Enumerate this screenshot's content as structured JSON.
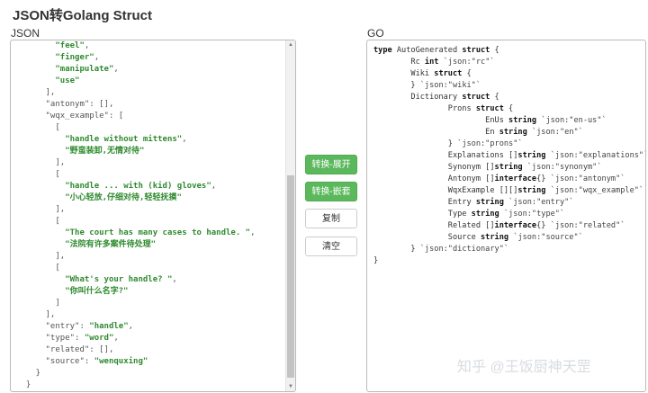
{
  "header": {
    "title": "JSON转Golang Struct"
  },
  "labels": {
    "json": "JSON",
    "go": "GO"
  },
  "buttons": {
    "convert_flat": "转换-展开",
    "convert_nested": "转换-嵌套",
    "copy": "复制",
    "clear": "清空"
  },
  "colors": {
    "primary_button": "#5cb85c",
    "json_string": "#2f8a2f"
  },
  "json_lines": [
    [
      {
        "t": "        "
      },
      {
        "t": "\"feel\"",
        "c": "str"
      },
      {
        "t": ",",
        "c": "pun"
      }
    ],
    [
      {
        "t": "        "
      },
      {
        "t": "\"finger\"",
        "c": "str"
      },
      {
        "t": ",",
        "c": "pun"
      }
    ],
    [
      {
        "t": "        "
      },
      {
        "t": "\"manipulate\"",
        "c": "str"
      },
      {
        "t": ",",
        "c": "pun"
      }
    ],
    [
      {
        "t": "        "
      },
      {
        "t": "\"use\"",
        "c": "str"
      }
    ],
    [
      {
        "t": "      ],",
        "c": "pun"
      }
    ],
    [
      {
        "t": "      "
      },
      {
        "t": "\"antonym\": [],",
        "c": "key"
      }
    ],
    [
      {
        "t": "      "
      },
      {
        "t": "\"wqx_example\": [",
        "c": "key"
      }
    ],
    [
      {
        "t": "        [",
        "c": "pun"
      }
    ],
    [
      {
        "t": "          "
      },
      {
        "t": "\"handle without mittens\"",
        "c": "str"
      },
      {
        "t": ",",
        "c": "pun"
      }
    ],
    [
      {
        "t": "          "
      },
      {
        "t": "\"野蛮装卸,无情对待\"",
        "c": "str"
      }
    ],
    [
      {
        "t": "        ],",
        "c": "pun"
      }
    ],
    [
      {
        "t": "        [",
        "c": "pun"
      }
    ],
    [
      {
        "t": "          "
      },
      {
        "t": "\"handle ... with (kid) gloves\"",
        "c": "str"
      },
      {
        "t": ",",
        "c": "pun"
      }
    ],
    [
      {
        "t": "          "
      },
      {
        "t": "\"小心轻放,仔细对待,轻轻抚摸\"",
        "c": "str"
      }
    ],
    [
      {
        "t": "        ],",
        "c": "pun"
      }
    ],
    [
      {
        "t": "        [",
        "c": "pun"
      }
    ],
    [
      {
        "t": "          "
      },
      {
        "t": "\"The court has many cases to handle. \"",
        "c": "str"
      },
      {
        "t": ",",
        "c": "pun"
      }
    ],
    [
      {
        "t": "          "
      },
      {
        "t": "\"法院有许多案件待处理\"",
        "c": "str"
      }
    ],
    [
      {
        "t": "        ],",
        "c": "pun"
      }
    ],
    [
      {
        "t": "        [",
        "c": "pun"
      }
    ],
    [
      {
        "t": "          "
      },
      {
        "t": "\"What's your handle? \"",
        "c": "str"
      },
      {
        "t": ",",
        "c": "pun"
      }
    ],
    [
      {
        "t": "          "
      },
      {
        "t": "\"你叫什么名字?\"",
        "c": "str"
      }
    ],
    [
      {
        "t": "        ]",
        "c": "pun"
      }
    ],
    [
      {
        "t": "      ],",
        "c": "pun"
      }
    ],
    [
      {
        "t": "      "
      },
      {
        "t": "\"entry\": ",
        "c": "key"
      },
      {
        "t": "\"handle\"",
        "c": "str"
      },
      {
        "t": ",",
        "c": "pun"
      }
    ],
    [
      {
        "t": "      "
      },
      {
        "t": "\"type\": ",
        "c": "key"
      },
      {
        "t": "\"word\"",
        "c": "str"
      },
      {
        "t": ",",
        "c": "pun"
      }
    ],
    [
      {
        "t": "      "
      },
      {
        "t": "\"related\": [],",
        "c": "key"
      }
    ],
    [
      {
        "t": "      "
      },
      {
        "t": "\"source\": ",
        "c": "key"
      },
      {
        "t": "\"wenquxing\"",
        "c": "str"
      }
    ],
    [
      {
        "t": "    }",
        "c": "pun"
      }
    ],
    [
      {
        "t": "  }",
        "c": "pun"
      }
    ]
  ],
  "go_lines": [
    [
      {
        "t": "type",
        "c": "kw"
      },
      {
        "t": " AutoGenerated "
      },
      {
        "t": "struct",
        "c": "kw"
      },
      {
        "t": " {"
      }
    ],
    [
      {
        "t": "        Rc "
      },
      {
        "t": "int",
        "c": "kw"
      },
      {
        "t": " `json:\"rc\"`",
        "c": "tg"
      }
    ],
    [
      {
        "t": "        Wiki "
      },
      {
        "t": "struct",
        "c": "kw"
      },
      {
        "t": " {"
      }
    ],
    [
      {
        "t": "        } "
      },
      {
        "t": "`json:\"wiki\"`",
        "c": "tg"
      }
    ],
    [
      {
        "t": "        Dictionary "
      },
      {
        "t": "struct",
        "c": "kw"
      },
      {
        "t": " {"
      }
    ],
    [
      {
        "t": "                Prons "
      },
      {
        "t": "struct",
        "c": "kw"
      },
      {
        "t": " {"
      }
    ],
    [
      {
        "t": "                        EnUs "
      },
      {
        "t": "string",
        "c": "kw"
      },
      {
        "t": " `json:\"en-us\"`",
        "c": "tg"
      }
    ],
    [
      {
        "t": "                        En "
      },
      {
        "t": "string",
        "c": "kw"
      },
      {
        "t": " `json:\"en\"`",
        "c": "tg"
      }
    ],
    [
      {
        "t": "                } "
      },
      {
        "t": "`json:\"prons\"`",
        "c": "tg"
      }
    ],
    [
      {
        "t": "                Explanations []"
      },
      {
        "t": "string",
        "c": "kw"
      },
      {
        "t": " `json:\"explanations\"`",
        "c": "tg"
      }
    ],
    [
      {
        "t": "                Synonym []"
      },
      {
        "t": "string",
        "c": "kw"
      },
      {
        "t": " `json:\"synonym\"`",
        "c": "tg"
      }
    ],
    [
      {
        "t": "                Antonym []"
      },
      {
        "t": "interface",
        "c": "kw"
      },
      {
        "t": "{} "
      },
      {
        "t": "`json:\"antonym\"`",
        "c": "tg"
      }
    ],
    [
      {
        "t": "                WqxExample [][]"
      },
      {
        "t": "string",
        "c": "kw"
      },
      {
        "t": " `json:\"wqx_example\"`",
        "c": "tg"
      }
    ],
    [
      {
        "t": "                Entry "
      },
      {
        "t": "string",
        "c": "kw"
      },
      {
        "t": " `json:\"entry\"`",
        "c": "tg"
      }
    ],
    [
      {
        "t": "                Type "
      },
      {
        "t": "string",
        "c": "kw"
      },
      {
        "t": " `json:\"type\"`",
        "c": "tg"
      }
    ],
    [
      {
        "t": "                Related []"
      },
      {
        "t": "interface",
        "c": "kw"
      },
      {
        "t": "{} "
      },
      {
        "t": "`json:\"related\"`",
        "c": "tg"
      }
    ],
    [
      {
        "t": "                Source "
      },
      {
        "t": "string",
        "c": "kw"
      },
      {
        "t": " `json:\"source\"`",
        "c": "tg"
      }
    ],
    [
      {
        "t": "        } "
      },
      {
        "t": "`json:\"dictionary\"`",
        "c": "tg"
      }
    ],
    [
      {
        "t": "}"
      }
    ]
  ],
  "watermark": "知乎 @王饭厨神天罡"
}
